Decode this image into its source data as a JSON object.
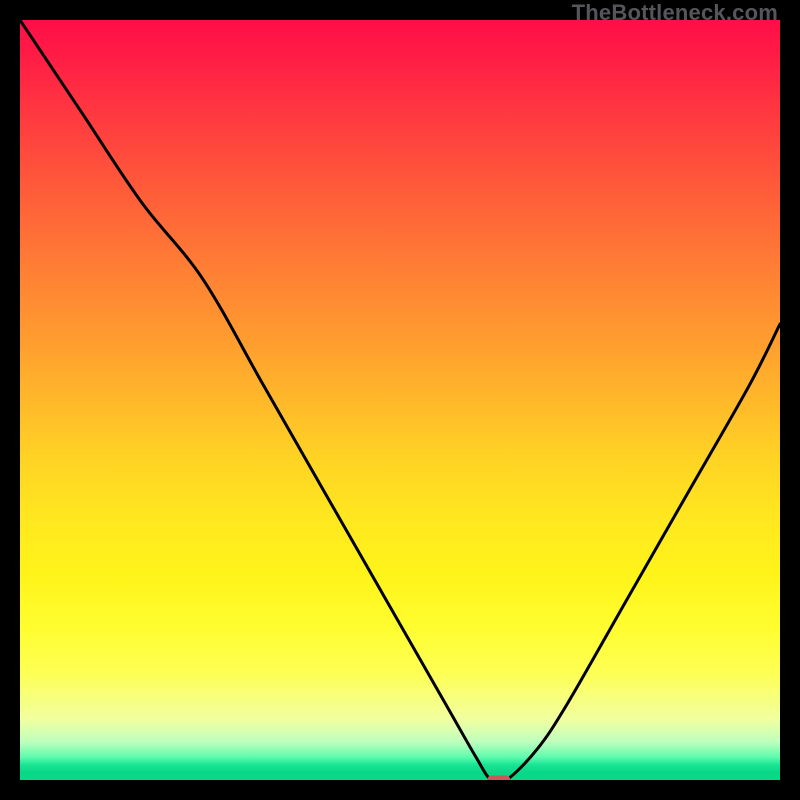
{
  "watermark": "TheBottleneck.com",
  "chart_data": {
    "type": "line",
    "title": "",
    "xlabel": "",
    "ylabel": "",
    "xlim": [
      0,
      100
    ],
    "ylim": [
      0,
      100
    ],
    "grid": false,
    "legend": false,
    "series": [
      {
        "name": "bottleneck-curve",
        "x": [
          0,
          8,
          16,
          24,
          32,
          40,
          48,
          56,
          60,
          62,
          64,
          68,
          72,
          80,
          88,
          96,
          100
        ],
        "values": [
          100,
          88,
          76,
          66,
          52,
          38,
          24,
          10,
          3,
          0,
          0,
          4,
          10,
          24,
          38,
          52,
          60
        ]
      }
    ],
    "minimum_marker": {
      "x": 63,
      "y": 0,
      "width": 3,
      "height": 1.2,
      "color": "#c75b5b"
    },
    "background_gradient_stops": [
      {
        "pct": 0,
        "color": "#ff0e49"
      },
      {
        "pct": 22,
        "color": "#ff5a3a"
      },
      {
        "pct": 50,
        "color": "#ffb82a"
      },
      {
        "pct": 73,
        "color": "#fff41a"
      },
      {
        "pct": 92,
        "color": "#f1ffa0"
      },
      {
        "pct": 98,
        "color": "#19e594"
      },
      {
        "pct": 100,
        "color": "#08d887"
      }
    ]
  }
}
